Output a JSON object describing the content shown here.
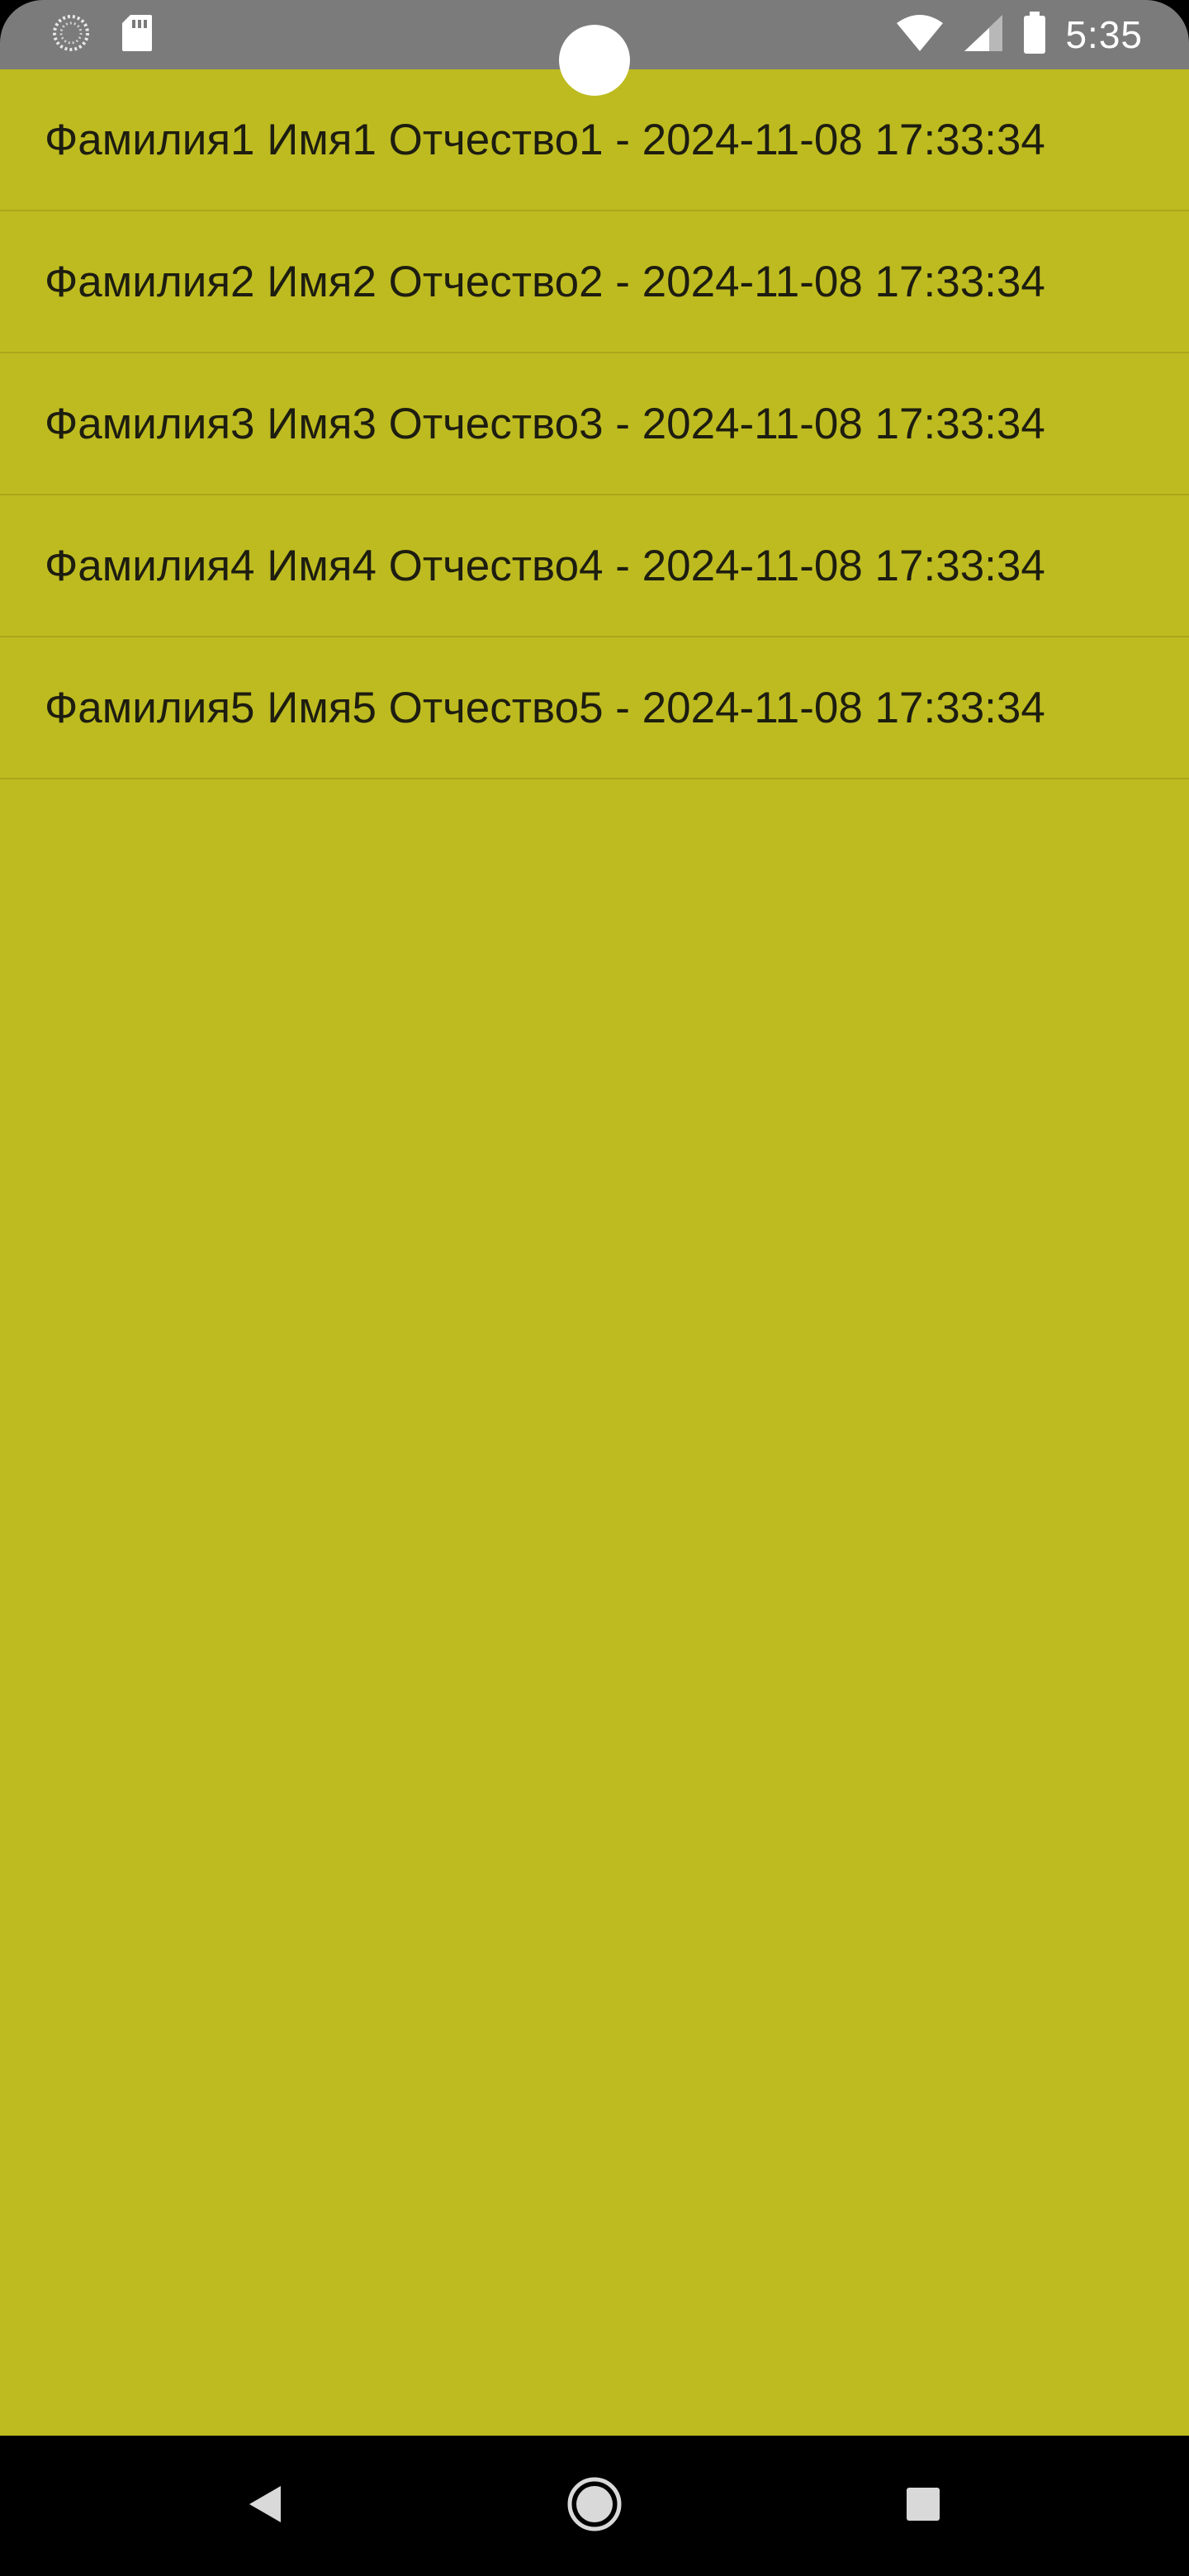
{
  "status_bar": {
    "time": "5:35",
    "left_icons": [
      "spinner-notification-icon",
      "sd-card-icon"
    ],
    "right_icons": [
      "wifi-icon",
      "cell-signal-icon",
      "battery-icon"
    ],
    "background_color": "#7b7b7b"
  },
  "list": {
    "background_color": "#bebb20",
    "items": [
      {
        "label": "Фамилия1 Имя1 Отчество1 - 2024-11-08 17:33:34"
      },
      {
        "label": "Фамилия2 Имя2 Отчество2 - 2024-11-08 17:33:34"
      },
      {
        "label": "Фамилия3 Имя3 Отчество3 - 2024-11-08 17:33:34"
      },
      {
        "label": "Фамилия4 Имя4 Отчество4 - 2024-11-08 17:33:34"
      },
      {
        "label": "Фамилия5 Имя5 Отчество5 - 2024-11-08 17:33:34"
      }
    ]
  },
  "nav_bar": {
    "buttons": [
      "back-icon",
      "home-icon",
      "recents-icon"
    ]
  }
}
